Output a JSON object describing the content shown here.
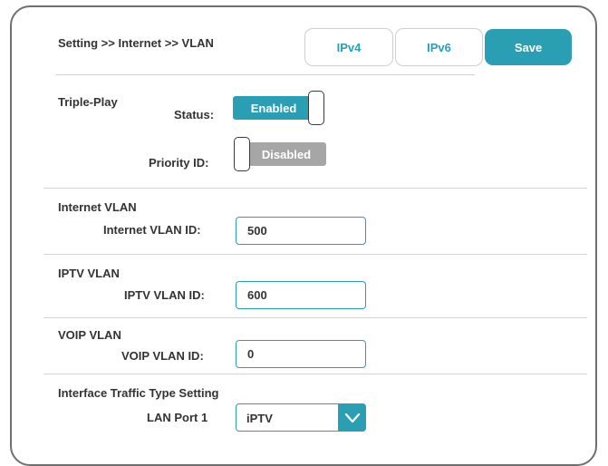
{
  "header": {
    "breadcrumb": "Setting >> Internet >> VLAN",
    "tabs": {
      "ipv4": "IPv4",
      "ipv6": "IPv6"
    },
    "save_label": "Save"
  },
  "triple_play": {
    "title": "Triple-Play",
    "status_label": "Status:",
    "status_value": "Enabled",
    "priority_label": "Priority ID:",
    "priority_value": "Disabled"
  },
  "internet_vlan": {
    "title": "Internet VLAN",
    "id_label": "Internet VLAN ID:",
    "id_value": "500"
  },
  "iptv_vlan": {
    "title": "IPTV VLAN",
    "id_label": "IPTV VLAN ID:",
    "id_value": "600"
  },
  "voip_vlan": {
    "title": "VOIP VLAN",
    "id_label": "VOIP VLAN ID:",
    "id_value": "0"
  },
  "traffic_type": {
    "title": "Interface Traffic Type Setting",
    "port_label": "LAN Port 1",
    "port_value": "iPTV"
  },
  "colors": {
    "accent": "#2a9fb3",
    "disabled": "#a6a6a6",
    "frame_border": "#6f6f6f"
  },
  "icons": {
    "dropdown": "chevron-down-icon"
  }
}
